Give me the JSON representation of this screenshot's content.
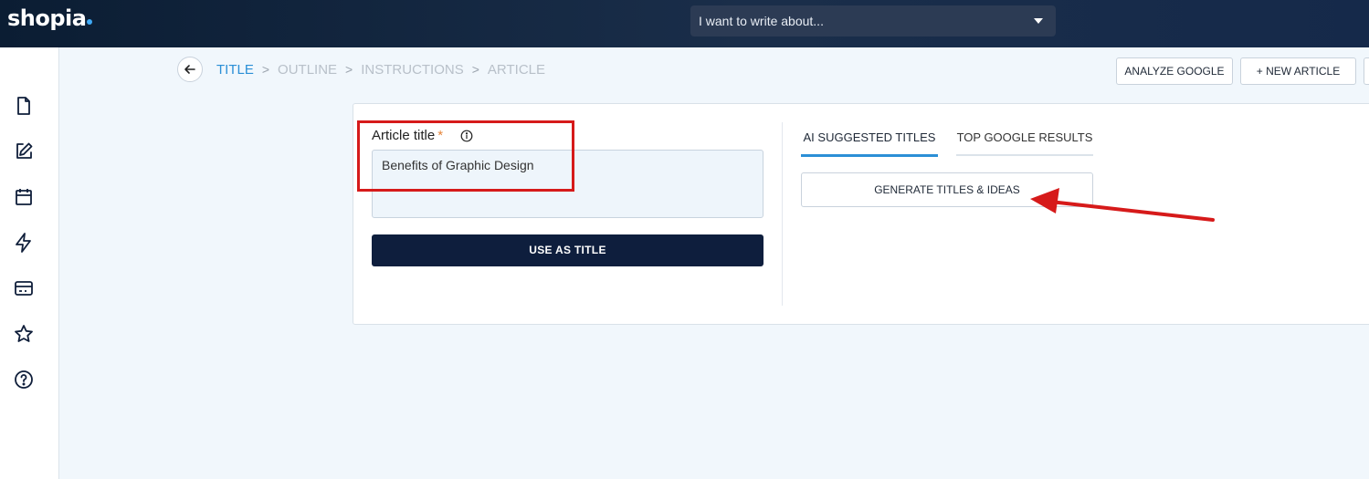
{
  "app": {
    "brand": "shopia"
  },
  "topbar": {
    "topic_placeholder": "I want to write about..."
  },
  "sidebar": {
    "items": [
      {
        "icon": "document-icon"
      },
      {
        "icon": "edit-icon"
      },
      {
        "icon": "calendar-icon"
      },
      {
        "icon": "lightning-icon"
      },
      {
        "icon": "credit-card-icon"
      },
      {
        "icon": "star-icon"
      },
      {
        "icon": "help-icon"
      }
    ]
  },
  "breadcrumb": {
    "steps": [
      "TITLE",
      "OUTLINE",
      "INSTRUCTIONS",
      "ARTICLE"
    ],
    "separator": ">"
  },
  "actions": {
    "analyze_google": "ANALYZE GOOGLE",
    "new_article": "+ NEW ARTICLE"
  },
  "form": {
    "title_label": "Article title",
    "required_mark": "*",
    "title_value": "Benefits of Graphic Design",
    "use_as_title": "USE AS TITLE"
  },
  "tabs": {
    "ai_suggested": "AI SUGGESTED TITLES",
    "top_google": "TOP GOOGLE RESULTS"
  },
  "generate_button": "GENERATE TITLES & IDEAS",
  "colors": {
    "accent": "#2b8fd6",
    "primary_dark": "#0e1e3d",
    "annotation_red": "#d61a1a",
    "required": "#e5853a"
  }
}
